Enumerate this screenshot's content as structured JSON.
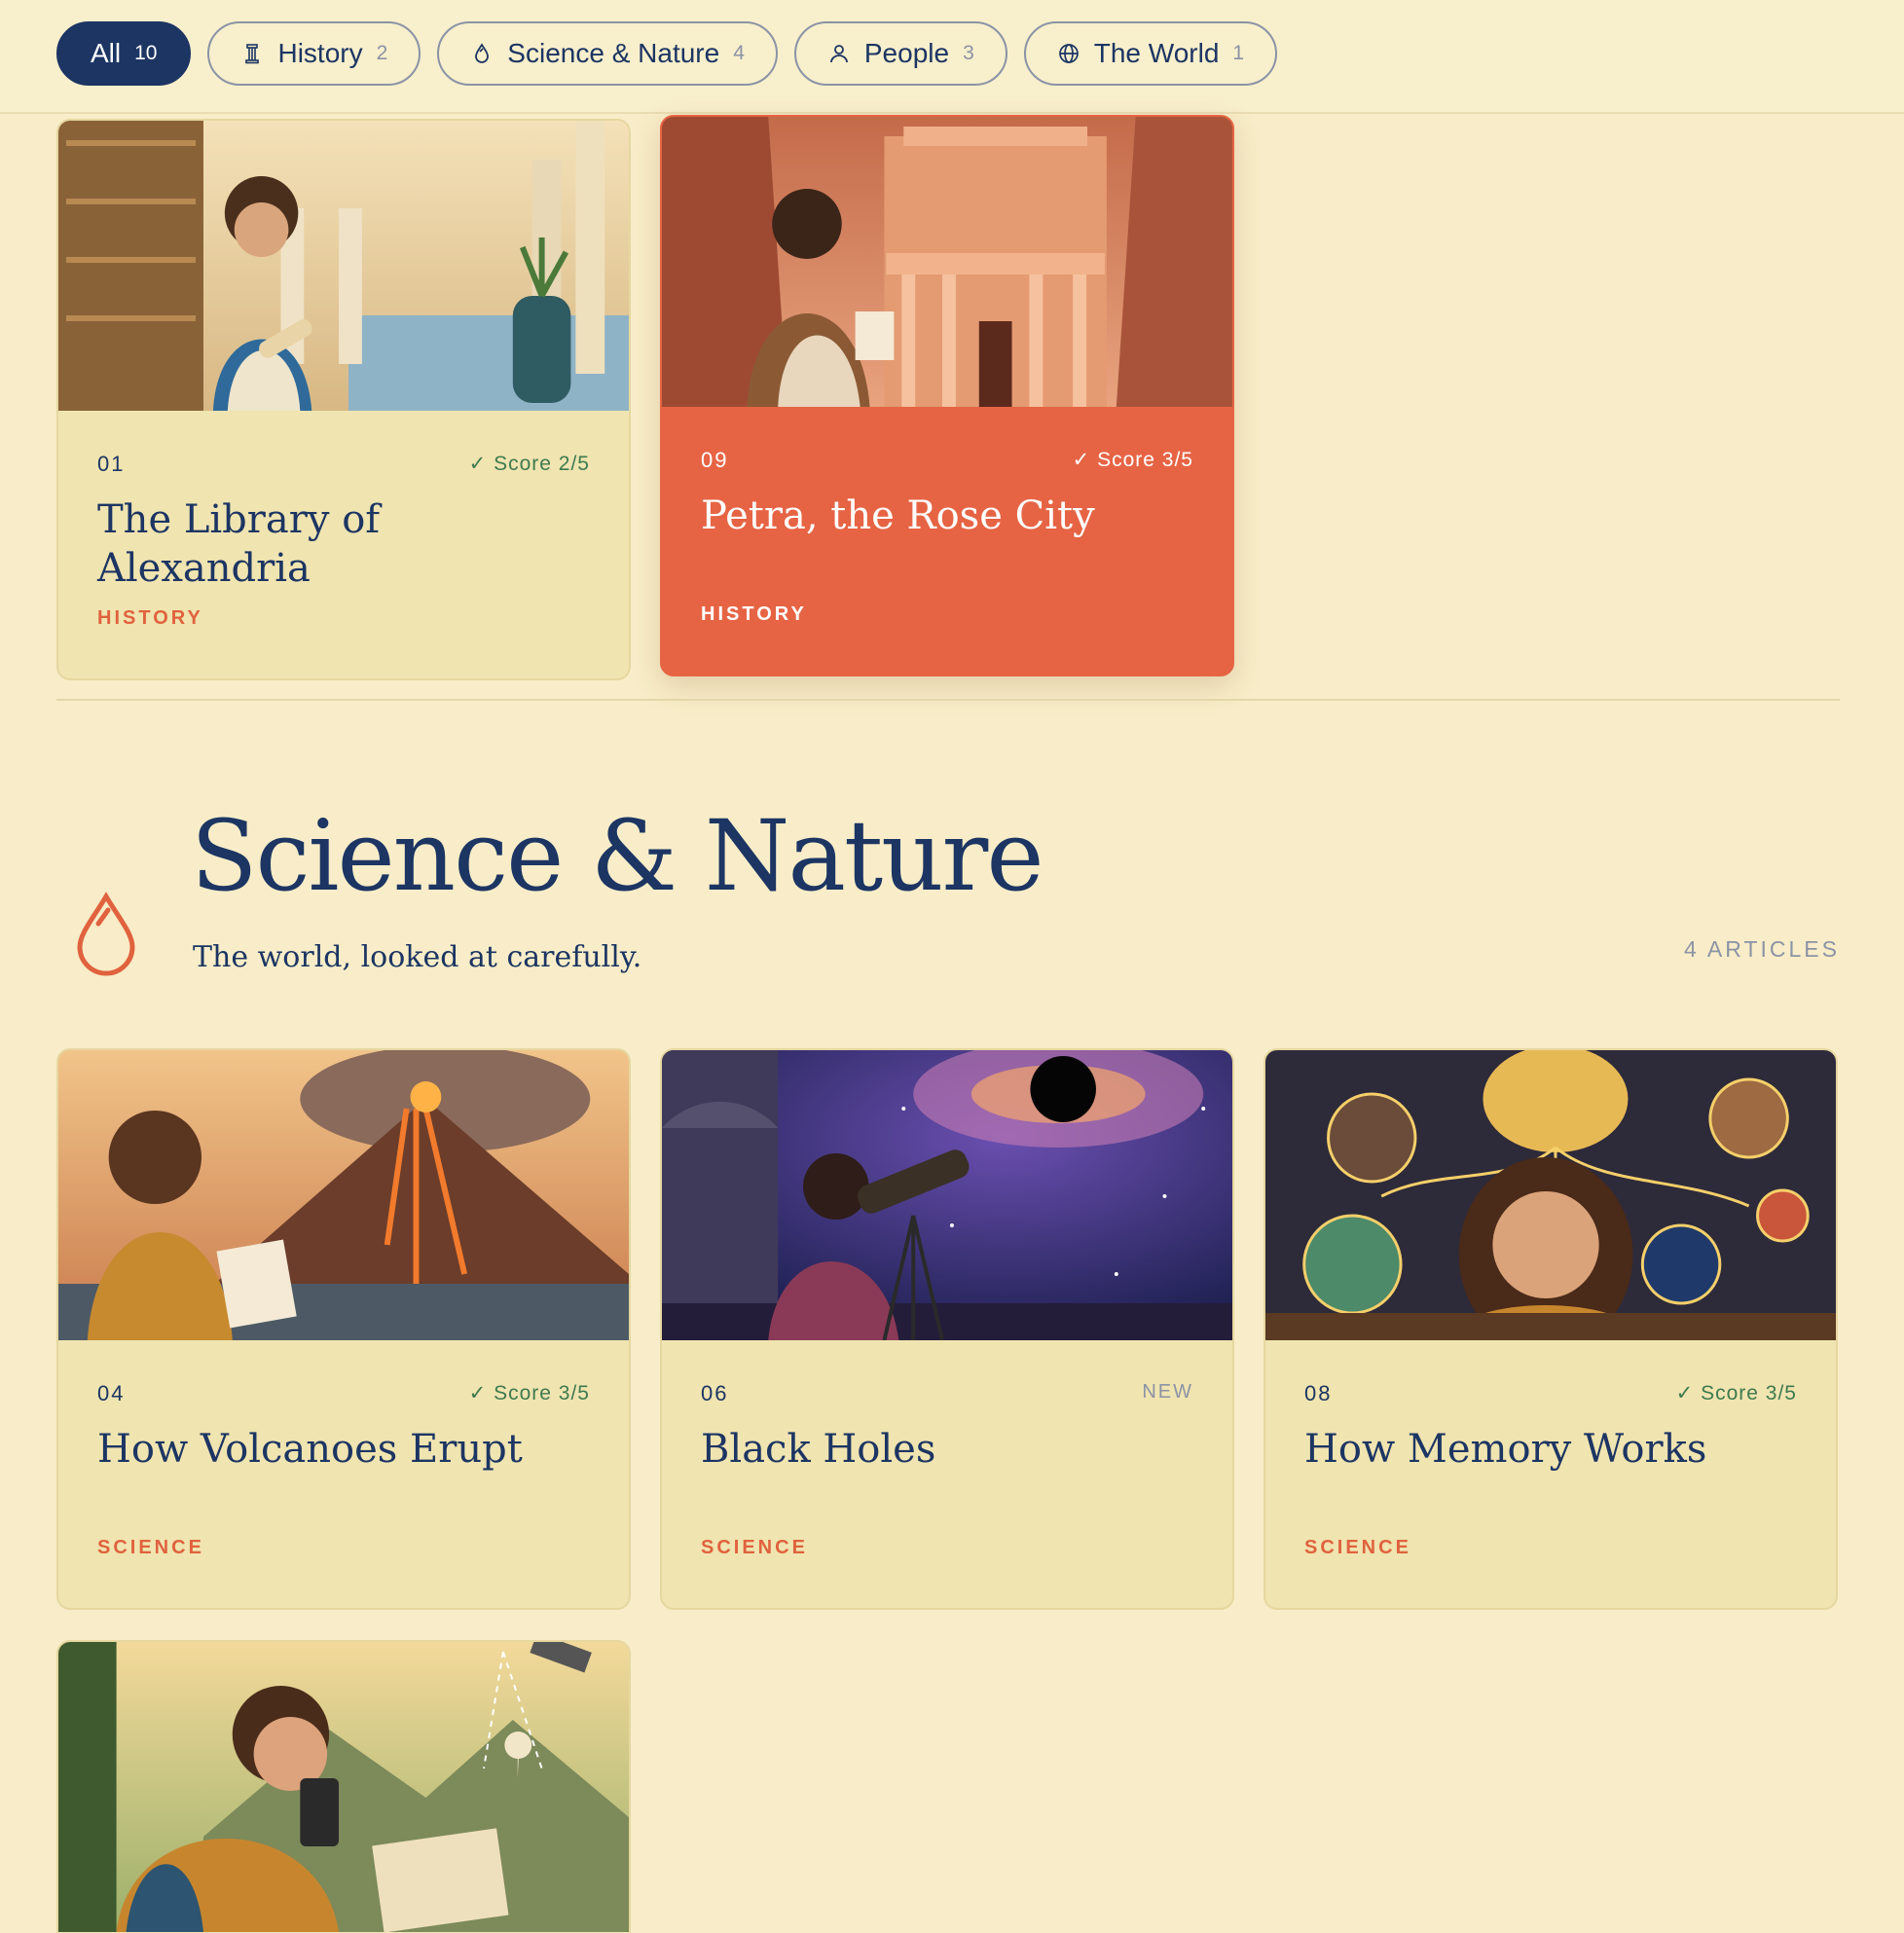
{
  "filters": [
    {
      "label": "All",
      "count": "10",
      "icon": "",
      "active": true
    },
    {
      "label": "History",
      "count": "2",
      "icon": "column-icon"
    },
    {
      "label": "Science & Nature",
      "count": "4",
      "icon": "drop-icon"
    },
    {
      "label": "People",
      "count": "3",
      "icon": "person-icon"
    },
    {
      "label": "The World",
      "count": "1",
      "icon": "globe-icon"
    }
  ],
  "history_cards": [
    {
      "num": "01",
      "score": "✓ Score 2/5",
      "title": "The Library of Alexandria",
      "category": "HISTORY"
    },
    {
      "num": "09",
      "score": "✓ Score 3/5",
      "title": "Petra, the Rose City",
      "category": "HISTORY"
    }
  ],
  "section": {
    "title": "Science & Nature",
    "subtitle": "The world, looked at carefully.",
    "count": "4 ARTICLES",
    "icon": "drop-icon"
  },
  "science_cards": [
    {
      "num": "04",
      "score": "✓ Score 3/5",
      "title": "How Volcanoes Erupt",
      "category": "SCIENCE"
    },
    {
      "num": "06",
      "badge": "NEW",
      "title": "Black Holes",
      "category": "SCIENCE"
    },
    {
      "num": "08",
      "score": "✓ Score 3/5",
      "title": "How Memory Works",
      "category": "SCIENCE"
    }
  ],
  "colors": {
    "background": "#f8edc8",
    "navy": "#1c3563",
    "accent": "#e66444",
    "card": "#f0e4b0",
    "score_green": "#3e7a4f"
  }
}
